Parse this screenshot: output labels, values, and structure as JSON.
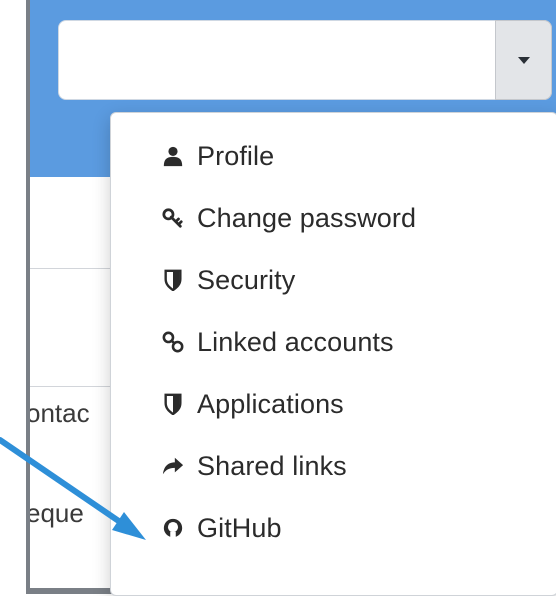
{
  "menu": {
    "items": [
      {
        "label": "Profile",
        "icon": "user-icon"
      },
      {
        "label": "Change password",
        "icon": "key-icon"
      },
      {
        "label": "Security",
        "icon": "shield-icon"
      },
      {
        "label": "Linked accounts",
        "icon": "link-icon"
      },
      {
        "label": "Applications",
        "icon": "shield-icon"
      },
      {
        "label": "Shared links",
        "icon": "share-arrow-icon"
      },
      {
        "label": "GitHub",
        "icon": "github-icon"
      }
    ]
  },
  "background": {
    "text_1": "ontac",
    "text_2": "eque"
  },
  "colors": {
    "header": "#5b9be0",
    "annotation_arrow": "#2e8fd8",
    "menu_text": "#2b2b2b"
  }
}
